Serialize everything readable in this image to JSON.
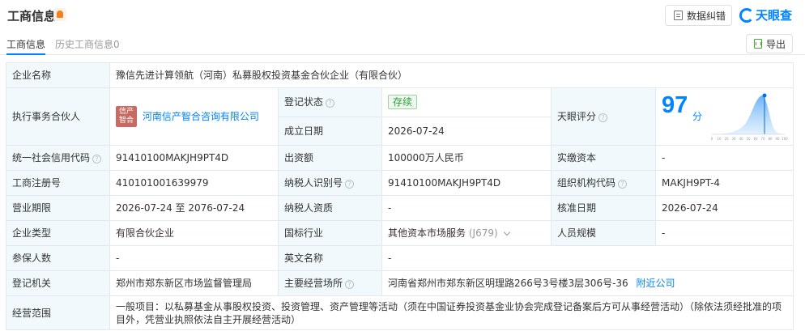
{
  "header": {
    "title": "工商信息",
    "fix_label": "数据纠错",
    "brand": "天眼查"
  },
  "tabs": [
    {
      "label": "工商信息"
    },
    {
      "label": "历史工商信息0"
    }
  ],
  "export_label": "导出",
  "labels": {
    "company_name": "企业名称",
    "partner": "执行事务合伙人",
    "reg_status": "登记状态",
    "found_date": "成立日期",
    "tyc_score": "天眼评分",
    "credit_code": "统一社会信用代码",
    "capital": "出资额",
    "paid_capital": "实缴资本",
    "reg_number": "工商注册号",
    "taxpayer_id": "纳税人识别号",
    "org_code": "组织机构代码",
    "term": "营业期限",
    "taxpayer_qual": "纳税人资质",
    "approval_date": "核准日期",
    "company_type": "企业类型",
    "industry": "国标行业",
    "staff_size": "人员规模",
    "insured": "参保人数",
    "english_name": "英文名称",
    "reg_authority": "登记机关",
    "address": "主要经营场所",
    "scope": "经营范围"
  },
  "values": {
    "company_name": "豫信先进计算领航（河南）私募股权投资基金合伙企业（有限合伙）",
    "partner_logo": "信产智合",
    "partner_logo_line1": "信产",
    "partner_logo_line2": "智合",
    "partner_logo_color": "#c96a62",
    "partner": "河南信产智合咨询有限公司",
    "reg_status": "存续",
    "found_date": "2026-07-24",
    "score": "97",
    "score_unit": "分",
    "credit_code": "91410100MAKJH9PT4D",
    "capital": "100000万人民币",
    "paid_capital": "-",
    "reg_number": "410101001639979",
    "taxpayer_id": "91410100MAKJH9PT4D",
    "org_code": "MAKJH9PT-4",
    "term": "2026-07-24 至 2076-07-24",
    "taxpayer_qual": "-",
    "approval_date": "2026-07-24",
    "company_type": "有限合伙企业",
    "industry": "其他资本市场服务",
    "industry_code": "(J679)",
    "staff_size": "-",
    "insured": "-",
    "english_name": "-",
    "reg_authority": "郑州市郑东新区市场监督管理局",
    "address": "河南省郑州市郑东新区明理路266号3号楼3层306号-36",
    "nearby": "附近公司",
    "scope": "一般项目：以私募基金从事股权投资、投资管理、资产管理等活动（须在中国证券投资基金业协会完成登记备案后方可从事经营活动）（除依法须经批准的项目外，凭营业执照依法自主开展经营活动）"
  },
  "score_axis": [
    "0",
    "10",
    "20",
    "30",
    "40",
    "50",
    "60",
    "70",
    "80",
    "90",
    "100"
  ],
  "accent_color": "#0084ff"
}
